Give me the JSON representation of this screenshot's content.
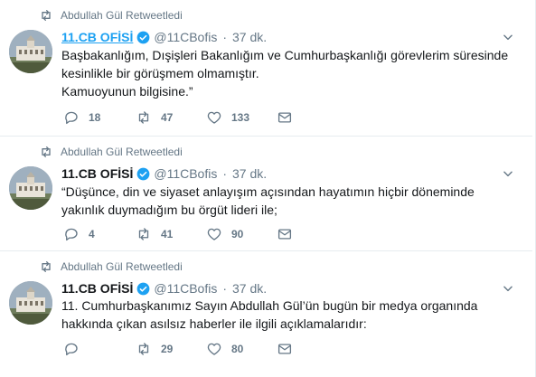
{
  "tweets": [
    {
      "retweet_context": "Abdullah Gül Retweetledi",
      "name": "11.CB OFİSİ",
      "name_linked": true,
      "handle": "@11CBofis",
      "separator": "·",
      "time": "37 dk.",
      "lines": [
        "Başbakanlığım, Dışişleri Bakanlığım ve Cumhurbaşkanlığı görevlerim süresinde",
        "kesinlikle bir görüşmem olmamıştır.",
        "Kamuoyunun bilgisine.”"
      ],
      "replies": "18",
      "retweets": "47",
      "likes": "133"
    },
    {
      "retweet_context": "Abdullah Gül Retweetledi",
      "name": "11.CB OFİSİ",
      "name_linked": false,
      "handle": "@11CBofis",
      "separator": "·",
      "time": "37 dk.",
      "lines": [
        "“Düşünce, din ve siyaset anlayışım açısından hayatımın hiçbir döneminde",
        "yakınlık duymadığım bu örgüt lideri ile;"
      ],
      "replies": "4",
      "retweets": "41",
      "likes": "90"
    },
    {
      "retweet_context": "Abdullah Gül Retweetledi",
      "name": "11.CB OFİSİ",
      "name_linked": false,
      "handle": "@11CBofis",
      "separator": "·",
      "time": "37 dk.",
      "lines": [
        "11. Cumhurbaşkanımız Sayın Abdullah Gül’ün bugün bir medya organında",
        "hakkında çıkan asılsız haberler ile ilgili açıklamalarıdır:"
      ],
      "replies": "",
      "retweets": "29",
      "likes": "80"
    }
  ],
  "icons": {
    "retweet_context": "retweet-icon",
    "verified": "verified-badge-icon",
    "caret": "chevron-down-icon",
    "reply": "reply-icon",
    "retweet": "retweet-icon",
    "like": "heart-icon",
    "dm": "envelope-icon"
  },
  "colors": {
    "link": "#1da1f2",
    "secondary": "#657786",
    "text": "#14171a",
    "divider": "#e6ecf0"
  }
}
